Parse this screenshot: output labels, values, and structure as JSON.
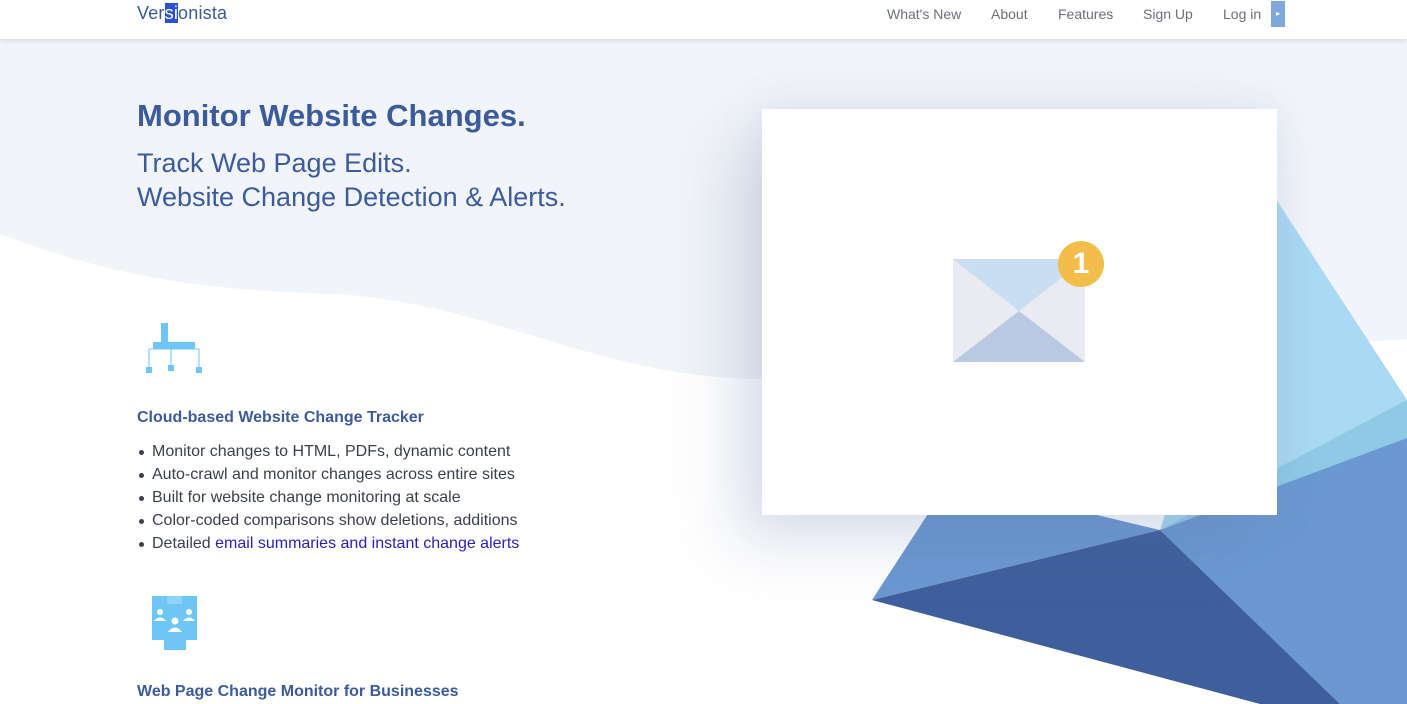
{
  "header": {
    "logo": {
      "pre": "Ver",
      "highlight": "si",
      "post": "onista"
    },
    "nav": [
      {
        "label": "What's New"
      },
      {
        "label": "About"
      },
      {
        "label": "Features"
      },
      {
        "label": "Sign Up"
      },
      {
        "label": "Log in"
      }
    ],
    "nav_arrow": "▸"
  },
  "hero": {
    "title": "Monitor Website Changes.",
    "subtitle_1": "Track Web Page Edits.",
    "subtitle_2": "Website Change Detection & Alerts."
  },
  "features": [
    {
      "icon": "sitemap-icon",
      "title": "Cloud-based Website Change Tracker",
      "bullets": [
        {
          "text": "Monitor changes to HTML, PDFs, dynamic content"
        },
        {
          "text": "Auto-crawl and monitor changes across entire sites"
        },
        {
          "text": "Built for website change monitoring at scale"
        },
        {
          "text": "Color-coded comparisons show deletions, additions"
        },
        {
          "text": "Detailed ",
          "link": "email summaries and instant change alerts"
        }
      ]
    },
    {
      "icon": "team-users-icon",
      "title": "Web Page Change Monitor for Businesses"
    }
  ],
  "mail_card": {
    "icon": "mail-icon",
    "badge": "1"
  },
  "colors": {
    "brand": "#3b5b9b",
    "link": "#2a22b8",
    "badge": "#f2bd4a",
    "icon_blue": "#6ec6f5"
  }
}
